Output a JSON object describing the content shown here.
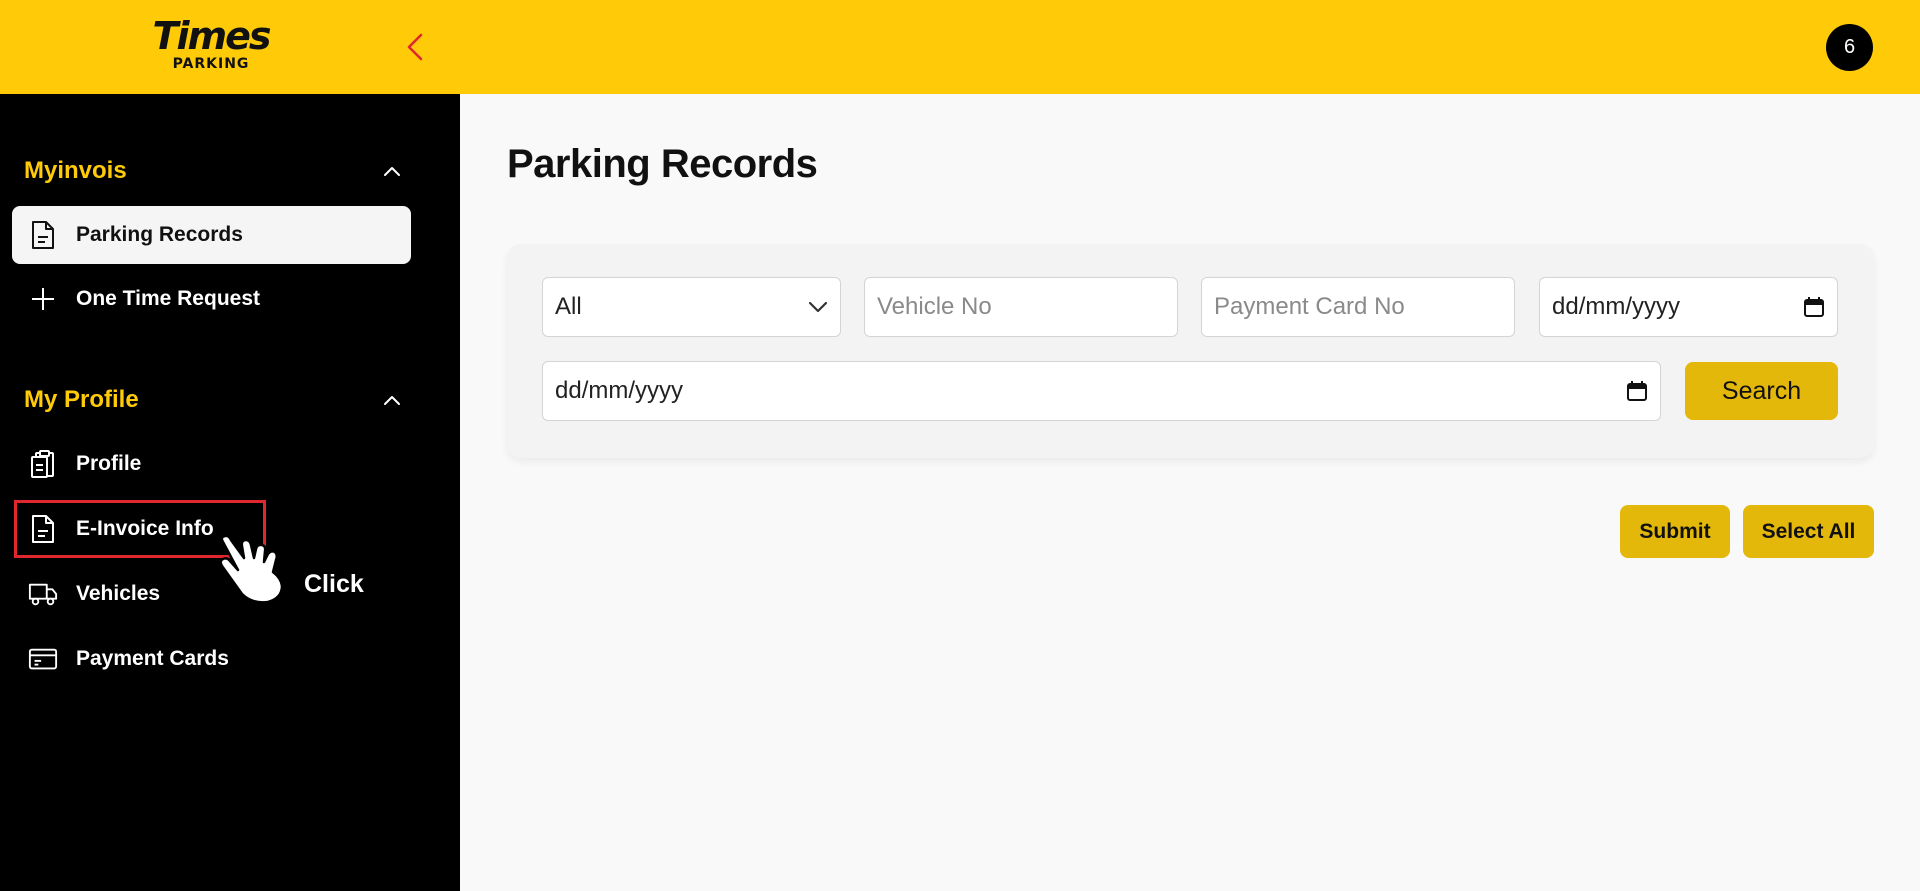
{
  "header": {
    "logo_main": "Times",
    "logo_sub": "PARKING",
    "avatar_text": "6"
  },
  "sidebar": {
    "sections": [
      {
        "title": "Myinvois",
        "items": [
          {
            "label": "Parking Records",
            "icon": "document-icon",
            "active": true
          },
          {
            "label": "One Time Request",
            "icon": "plus-icon",
            "active": false
          }
        ]
      },
      {
        "title": "My Profile",
        "items": [
          {
            "label": "Profile",
            "icon": "clipboard-icon",
            "active": false
          },
          {
            "label": "E-Invoice Info",
            "icon": "document-icon",
            "active": false
          },
          {
            "label": "Vehicles",
            "icon": "truck-icon",
            "active": false
          },
          {
            "label": "Payment Cards",
            "icon": "credit-card-icon",
            "active": false
          }
        ]
      }
    ]
  },
  "annotation": {
    "click_label": "Click"
  },
  "main": {
    "title": "Parking Records",
    "filters": {
      "type_select": {
        "value": "All"
      },
      "vehicle_no": {
        "placeholder": "Vehicle No"
      },
      "payment_card_no": {
        "placeholder": "Payment Card No"
      },
      "date_from": {
        "placeholder": "dd/mm/yyyy"
      },
      "date_to": {
        "placeholder": "dd/mm/yyyy"
      },
      "search_label": "Search"
    },
    "actions": {
      "submit_label": "Submit",
      "select_all_label": "Select All"
    }
  },
  "colors": {
    "brand_yellow": "#ffcb08",
    "button_yellow": "#e3b80a",
    "sidebar_bg": "#000000",
    "highlight_red": "#e0272f"
  }
}
